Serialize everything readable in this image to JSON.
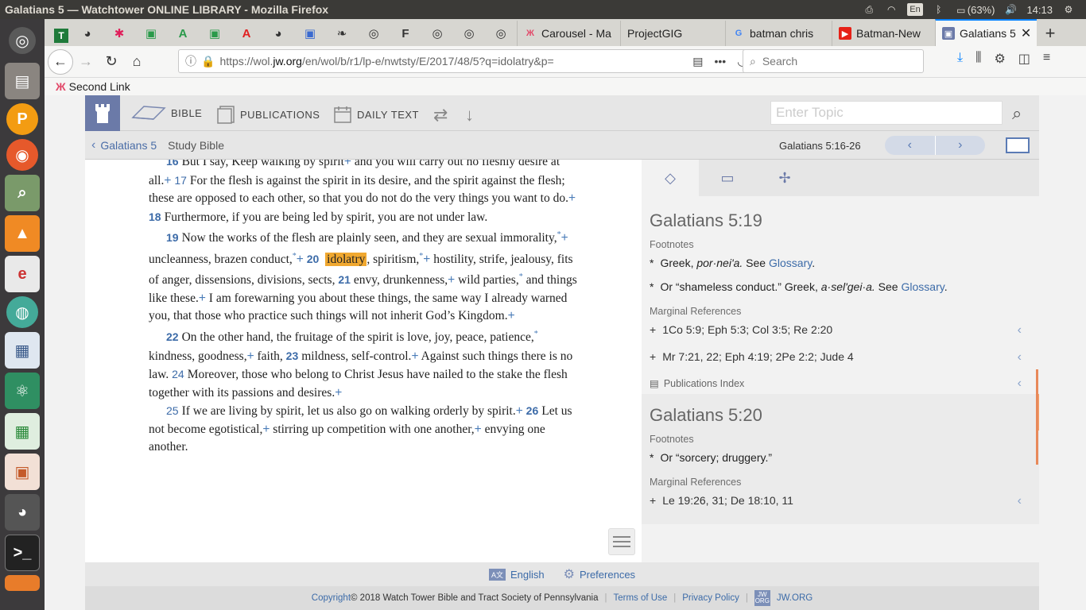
{
  "os": {
    "window_title": "Galatians 5 — Watchtower ONLINE LIBRARY - Mozilla Firefox",
    "keyboard_lang": "En",
    "battery": "(63%)",
    "clock": "14:13"
  },
  "browser": {
    "tabs": [
      {
        "label": "Carousel - Ma"
      },
      {
        "label": "ProjectGIG"
      },
      {
        "label": "batman chris"
      },
      {
        "label": "Batman-New"
      },
      {
        "label": "Galatians 5"
      }
    ],
    "url_prefix": "https://wol.",
    "url_domain": "jw.org",
    "url_rest": "/en/wol/b/r1/lp-e/nwtsty/E/2017/48/5?q=idolatry&p=",
    "search_placeholder": "Search",
    "bookmark": "Second Link"
  },
  "site": {
    "nav": {
      "bible": "BIBLE",
      "publications": "PUBLICATIONS",
      "daily_text": "DAILY TEXT"
    },
    "topic_placeholder": "Enter Topic",
    "breadcrumb_link": "Galatians 5",
    "breadcrumb_current": "Study Bible",
    "verse_range": "Galatians 5:16-26"
  },
  "verses": {
    "v16n": "16",
    "v16a": "But I say, Keep walking by spirit",
    "v16b": " and you will carry out no fleshly desire at all.",
    "v17n": "17",
    "v17a": "For the flesh is against the spirit in its desire, and the spirit against the flesh; these are opposed to each other, so that you do not do the very things you want to do.",
    "v18n": "18",
    "v18a": "Furthermore, if you are being led by spirit, you are not under law.",
    "v19n": "19",
    "v19a": "Now the works of the flesh are plainly seen, and they are sexual immorality,",
    "v19b": " uncleanness, brazen conduct,",
    "v20n": "20",
    "v20hl": "idolatry",
    "v20a": ", spiritism,",
    "v20b": " hostility, strife, jealousy, fits of anger, dissensions, divisions, sects,",
    "v21n": "21",
    "v21a": "envy, drunkenness,",
    "v21b": " wild parties,",
    "v21c": " and things like these.",
    "v21d": " I am forewarning you about these things, the same way I already warned you, that those who practice such things will not inherit God’s Kingdom.",
    "v22n": "22",
    "v22a": "On the other hand, the fruitage of the spirit is love, joy, peace, patience,",
    "v22b": " kindness, goodness,",
    "v22c": " faith,",
    "v23n": "23",
    "v23a": "mildness, self-control.",
    "v23b": " Against such things there is no law.",
    "v24n": "24",
    "v24a": "Moreover, those who belong to Christ Jesus have nailed to the stake the flesh together with its passions and desires.",
    "v25n": "25",
    "v25a": "If we are living by spirit, let us also go on walking orderly by spirit.",
    "v26n": "26",
    "v26a": "Let us not become egotistical,",
    "v26b": " stirring up competition with one another,",
    "v26c": " envying one another.",
    "plus": "+",
    "ast": "*"
  },
  "sidebar": {
    "s1_title": "Galatians 5:19",
    "footnotes_label": "Footnotes",
    "fn1_pre": "Greek, ",
    "fn1_it": "por·neiʹa.",
    "fn1_see": " See ",
    "glossary": "Glossary",
    "fn2_pre": "Or “shameless conduct.” Greek, ",
    "fn2_it": "a·selʹgei·a.",
    "marginal_label": "Marginal References",
    "mr1": "1Co 5:9; Eph 5:3; Col 3:5; Re 2:20",
    "mr2": "Mr 7:21, 22; Eph 4:19; 2Pe 2:2; Jude 4",
    "pub_index": "Publications Index",
    "s2_title": "Galatians 5:20",
    "fn3": "Or “sorcery; druggery.”",
    "mr3": "Le 19:26, 31; De 18:10, 11"
  },
  "footer": {
    "english": "English",
    "preferences": "Preferences",
    "copyright_link": "Copyright",
    "copyright_text": "© 2018 Watch Tower Bible and Tract Society of Pennsylvania",
    "terms": "Terms of Use",
    "privacy": "Privacy Policy",
    "jw_badge": "JW ORG",
    "jw_org": "JW.ORG"
  },
  "colors": {
    "accent": "#3c6ba8",
    "highlight": "#f0a830",
    "header_blue": "#6b7aa8"
  }
}
